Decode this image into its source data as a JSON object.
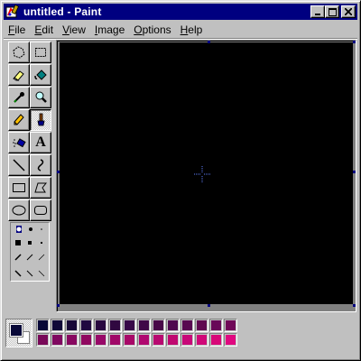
{
  "window": {
    "title": "untitled - Paint",
    "buttons": {
      "minimize": "_",
      "maximize": "□",
      "close": "×"
    }
  },
  "menu": {
    "items": [
      {
        "label": "File",
        "accel": "F",
        "rest": "ile"
      },
      {
        "label": "Edit",
        "accel": "E",
        "rest": "dit"
      },
      {
        "label": "View",
        "accel": "V",
        "rest": "iew"
      },
      {
        "label": "Image",
        "accel": "I",
        "rest": "mage"
      },
      {
        "label": "Options",
        "accel": "O",
        "rest": "ptions"
      },
      {
        "label": "Help",
        "accel": "H",
        "rest": "elp"
      }
    ]
  },
  "tools": [
    {
      "name": "free-form-select-icon"
    },
    {
      "name": "rect-select-icon"
    },
    {
      "name": "eraser-icon"
    },
    {
      "name": "fill-bucket-icon"
    },
    {
      "name": "color-picker-icon"
    },
    {
      "name": "magnifier-icon"
    },
    {
      "name": "pencil-icon"
    },
    {
      "name": "brush-icon",
      "pressed": true
    },
    {
      "name": "airbrush-icon"
    },
    {
      "name": "text-icon",
      "glyph": "A"
    },
    {
      "name": "line-icon"
    },
    {
      "name": "curve-icon"
    },
    {
      "name": "rectangle-icon"
    },
    {
      "name": "polygon-icon"
    },
    {
      "name": "ellipse-icon"
    },
    {
      "name": "rounded-rect-icon"
    }
  ],
  "colors": {
    "foreground": "#080838",
    "background": "#ffffff",
    "palette_top": [
      "#080838",
      "#100838",
      "#180838",
      "#200840",
      "#280840",
      "#300840",
      "#380848",
      "#400848",
      "#480848",
      "#500850",
      "#580850",
      "#600850",
      "#680858",
      "#700858"
    ],
    "palette_bottom": [
      "#780858",
      "#800860",
      "#880860",
      "#900860",
      "#980868",
      "#a00868",
      "#a80868",
      "#b00870",
      "#b80870",
      "#c00870",
      "#c80878",
      "#d00878",
      "#d80878",
      "#e00880"
    ]
  }
}
